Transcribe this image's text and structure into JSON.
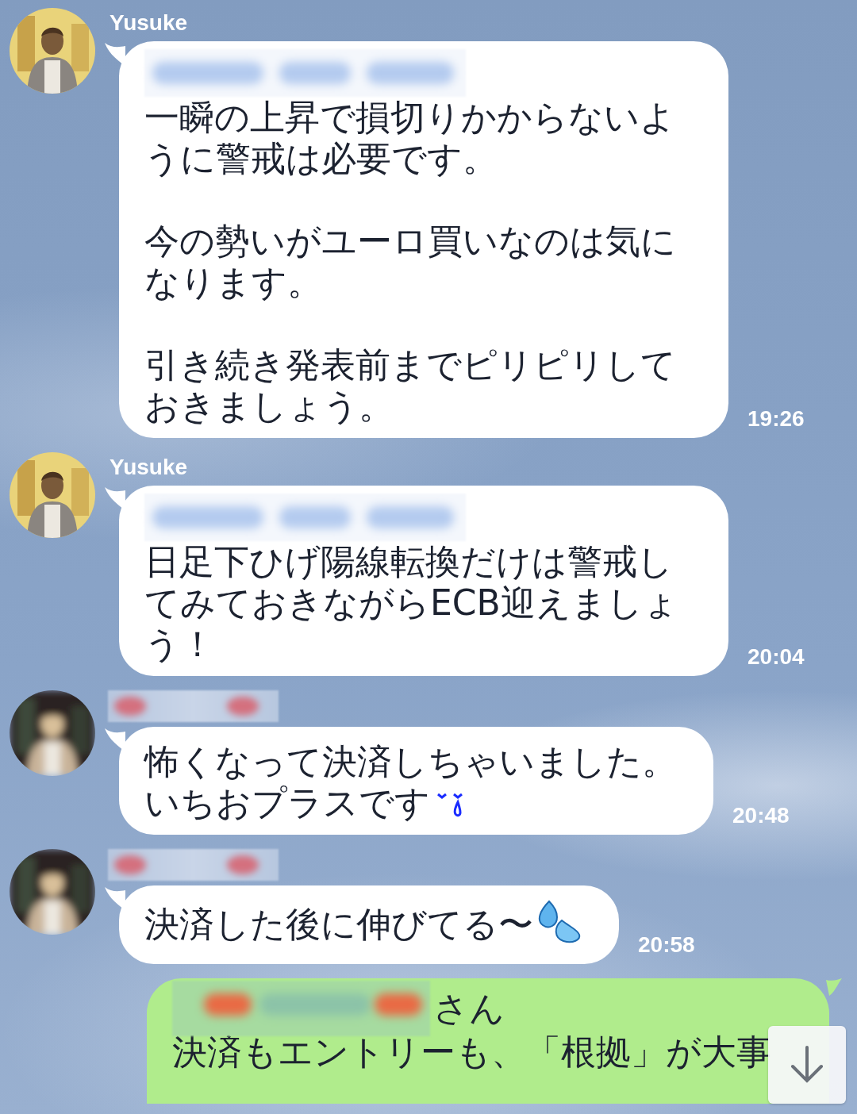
{
  "messages": [
    {
      "kind": "incoming",
      "sender": "Yusuke",
      "sender_hidden": false,
      "mention_hidden": true,
      "paragraphs": [
        "一瞬の上昇で損切りかからないように警戒は必要です。",
        "今の勢いがユーロ買いなのは気になります。",
        "引き続き発表前までピリピリしておきましょう。"
      ],
      "time": "19:26"
    },
    {
      "kind": "incoming",
      "sender": "Yusuke",
      "sender_hidden": false,
      "mention_hidden": true,
      "paragraphs": [
        "日足下ひげ陽線転換だけは警戒してみておきながらECB迎えましょう！"
      ],
      "time": "20:04"
    },
    {
      "kind": "incoming",
      "sender_hidden": true,
      "mention_hidden": false,
      "lines": [
        "怖くなって決済しちゃいました。",
        "いちおプラスです"
      ],
      "emoji": {
        "kind": "tear"
      },
      "time": "20:48"
    },
    {
      "kind": "incoming",
      "sender_hidden": true,
      "mention_hidden": false,
      "paragraphs": [
        "決済した後に伸びてる〜"
      ],
      "emoji": {
        "kind": "droplets"
      },
      "time": "20:58"
    },
    {
      "kind": "outgoing",
      "mention_hidden": true,
      "mention_suffix": "さん",
      "paragraphs": [
        "決済もエントリーも、「根拠」が大事"
      ]
    }
  ]
}
